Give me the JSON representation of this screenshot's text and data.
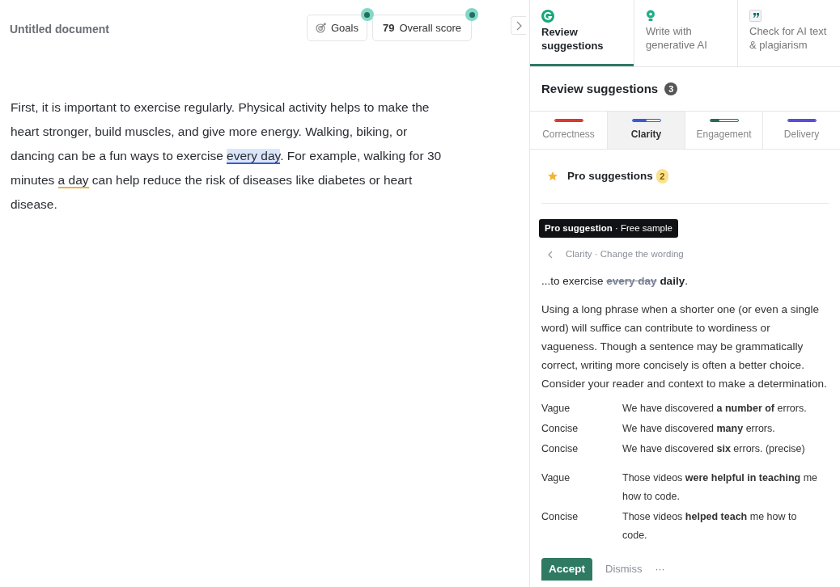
{
  "document": {
    "title": "Untitled document",
    "goals_label": "Goals",
    "score": "79",
    "score_label": "Overall score",
    "segments": [
      {
        "kind": "plain",
        "text": "First, it is important to exercise regularly. Physical activity helps to make the heart stronger, build muscles, and give more energy. Walking, biking, or dancing can be a fun ways to exercise "
      },
      {
        "kind": "clarity",
        "text": "every day"
      },
      {
        "kind": "plain",
        "text": ". For example, walking for 30 minutes "
      },
      {
        "kind": "engagement",
        "text": "a day"
      },
      {
        "kind": "plain",
        "text": " can help reduce the risk of diseases like diabetes or heart disease."
      }
    ]
  },
  "panel": {
    "tabs": [
      {
        "kind": "logo",
        "label": "Review suggestions",
        "selected": true
      },
      {
        "kind": "bulb",
        "label": "Write with generative AI",
        "selected": false
      },
      {
        "kind": "quote",
        "label": "Check for AI text & plagiarism",
        "selected": false
      }
    ],
    "heading": "Review suggestions",
    "count": "3",
    "categories": [
      {
        "label": "Correctness",
        "color": "#d93a2f",
        "level": 1,
        "selected": false
      },
      {
        "label": "Clarity",
        "color": "#3a5bd1",
        "level": 0.5,
        "selected": true
      },
      {
        "label": "Engagement",
        "color": "#2a6b52",
        "level": 0.35,
        "selected": false
      },
      {
        "label": "Delivery",
        "color": "#5b4dd6",
        "level": 1,
        "selected": false
      }
    ],
    "pro_heading": "Pro suggestions",
    "pro_count": "2",
    "tag": "**Pro suggestion** · Free sample",
    "breadcrumb": "Clarity · Change the wording",
    "preview": {
      "before": "...to exercise ",
      "removed": "every day",
      "added": "daily",
      "after": "."
    },
    "explanation": "Using a long phrase when a shorter one (or even a single word) will suffice can contribute to wordiness or vagueness. Though a sentence may be grammatically correct, writing more concisely is often a better choice. Consider your reader and context to make a determination.",
    "example_groups": [
      [
        {
          "label": "Vague",
          "text": "We have discovered **a number of** errors."
        },
        {
          "label": "Concise",
          "text": "We have discovered **many** errors."
        },
        {
          "label": "Concise",
          "text": "We have discovered **six** errors. (precise)"
        }
      ],
      [
        {
          "label": "Vague",
          "text": "Those videos **were helpful in teaching** me how to code."
        },
        {
          "label": "Concise",
          "text": "Those videos **helped teach** me how to code."
        }
      ]
    ],
    "buttons": {
      "accept": "Accept",
      "dismiss": "Dismiss",
      "more": "···"
    }
  }
}
